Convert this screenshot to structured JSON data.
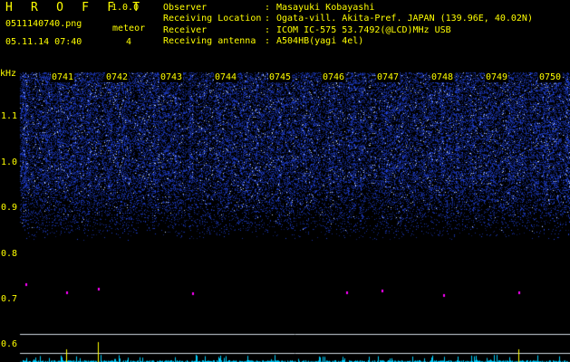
{
  "header": {
    "title": "H R O F F T",
    "version": "1.0.0",
    "filename": "0511140740.png",
    "datetime": "05.11.14 07:40",
    "meteor_label": "meteor",
    "meteor_count": "4"
  },
  "info": [
    {
      "key": "Observer",
      "value": "Masayuki Kobayashi"
    },
    {
      "key": "Receiving Location",
      "value": "Ogata-vill. Akita-Pref. JAPAN (139.96E, 40.02N)"
    },
    {
      "key": "Receiver",
      "value": "ICOM IC-575 53.7492(@LCD)MHz USB"
    },
    {
      "key": "Receiving antenna",
      "value": "A504HB(yagi 4el)"
    }
  ],
  "spectrogram": {
    "unit": "kHz",
    "freq_ticks": [
      "1.1",
      "1.0",
      "0.9",
      "0.8",
      "0.7",
      "0.6"
    ],
    "freq_tick_values": [
      1.1,
      1.0,
      0.9,
      0.8,
      0.7,
      0.6
    ],
    "time_ticks": [
      "0741",
      "0742",
      "0743",
      "0744",
      "0745",
      "0746",
      "0747",
      "0748",
      "0749",
      "0750"
    ],
    "colors": {
      "text": "#ffff00",
      "background": "#000000",
      "noise": "#1e3cdc",
      "meteor_marker": "#ff00ff",
      "guide_line": "#cfd8e0",
      "activity_trace": "#00d0ff"
    }
  }
}
